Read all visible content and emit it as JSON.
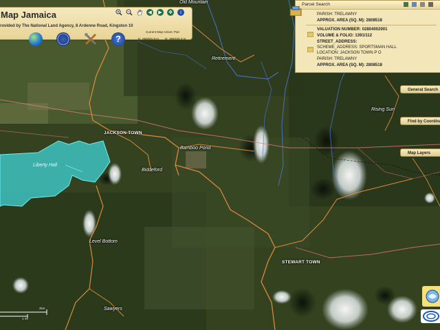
{
  "header": {
    "title": "Map Jamaica",
    "subtitle": "rovided by The National Land Agency, 8 Ardenne Road, Kingston 10",
    "current_action_label": "Current Map Action: Pan",
    "easting_label": "E:",
    "easting_value": "659291.8 m",
    "northing_label": "N:",
    "northing_value": "695330.3 m",
    "nav_icons": [
      "zoom-in-icon",
      "zoom-out-icon",
      "pan-hand-icon",
      "back-arrow-icon",
      "forward-arrow-icon",
      "full-extent-icon",
      "info-icon"
    ],
    "tool_icons": [
      "globe-icon",
      "compass-icon",
      "tools-icon",
      "help-icon"
    ]
  },
  "parcel_search": {
    "title": "Parcel Search",
    "record1": {
      "parish": "PARISH: TRELAWNY",
      "area": "APPROX. AREA (SQ. M): 2808518"
    },
    "record2": {
      "valuation": "VALUATION NUMBER: 02804002001",
      "volume": "VOLUME & FOLIO: 1391/112",
      "street": "STREET_ADDRESS:",
      "scheme": "SCHEME_ADDRESS: SPORTSMAN HALL",
      "location": "LOCATION: JACKSON TOWN P O",
      "parish": "PARISH: TRELAWNY",
      "area": "APPROX. AREA (SQ. M): 2808518"
    }
  },
  "side_tabs": {
    "general_search": "General Search",
    "find_by_coords": "Find by Coordinates",
    "map_layers": "Map Layers"
  },
  "places": {
    "old_mountain": "Old Mountain",
    "retirement": "Retirement",
    "rising_sun": "Rising Sun",
    "jackson_town": "JACKSON TOWN",
    "bamboo_pond": "Bamboo Pond",
    "biddeford": "Biddeford",
    "liberty_hall": "Liberty Hall",
    "level_bottom": "Level Bottom",
    "stewart_town": "STEWART TOWN",
    "sawyers": "Sawyers"
  },
  "scale": {
    "top": "2km",
    "bottom": "1 mi"
  },
  "colors": {
    "panel_bg": "#f3e7b9",
    "parcel_highlight": "#3fd4d8",
    "road": "#d98b3a",
    "river": "#4a78d8",
    "boundary": "#e07a80"
  }
}
